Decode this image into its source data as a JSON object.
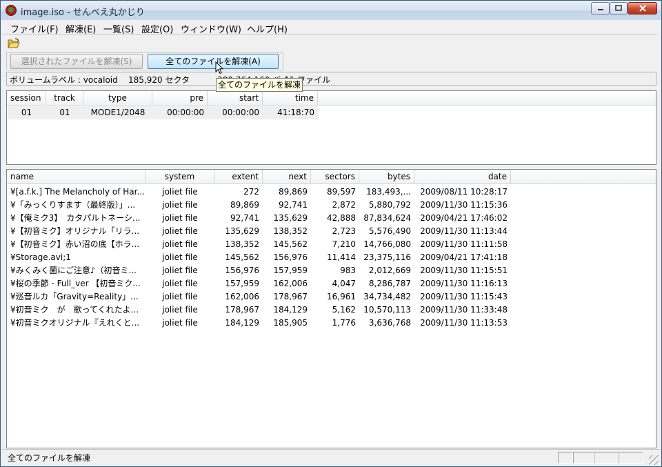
{
  "window": {
    "title": "image.iso - せんべえ丸かじり",
    "min_icon": "minimize-icon",
    "max_icon": "maximize-icon",
    "close_icon": "close-icon"
  },
  "menu": [
    "ファイル(F)",
    "解凍(E)",
    "一覧(S)",
    "設定(O)",
    "ウィンドウ(W)",
    "ヘルプ(H)"
  ],
  "toolbar": {
    "open_icon": "folder-open-icon"
  },
  "buttons": {
    "extract_selected": "選択されたファイルを解凍(S)",
    "extract_all": "全てのファイルを解凍(A)"
  },
  "volume": {
    "label": "ボリュームラベル : vocaloid",
    "sectors": "185,920 セクタ",
    "bytes": "380,764,160 バイト",
    "files": "11 ファイル"
  },
  "tooltip": "全てのファイルを解凍",
  "sessions": {
    "columns": [
      "session",
      "track",
      "type",
      "pre",
      "start",
      "time"
    ],
    "rows": [
      [
        "01",
        "01",
        "MODE1/2048",
        "00:00:00",
        "00:00:00",
        "41:18:70"
      ]
    ]
  },
  "files": {
    "columns": [
      "name",
      "system",
      "extent",
      "next",
      "sectors",
      "bytes",
      "date"
    ],
    "rows": [
      [
        "¥[a.f.k.] The Melancholy of Har...",
        "joliet file",
        "272",
        "89,869",
        "89,597",
        "183,493,...",
        "2009/08/11 10:28:17"
      ],
      [
        "¥「みっくりすます（最終版）」...",
        "joliet file",
        "89,869",
        "92,741",
        "2,872",
        "5,880,792",
        "2009/11/30 11:15:36"
      ],
      [
        "¥【俺ミク3】　カタパルトネーシ...",
        "joliet file",
        "92,741",
        "135,629",
        "42,888",
        "87,834,624",
        "2009/04/21 17:46:02"
      ],
      [
        "¥【初音ミク】オリジナル「リラ...",
        "joliet file",
        "135,629",
        "138,352",
        "2,723",
        "5,576,490",
        "2009/11/30 11:13:44"
      ],
      [
        "¥【初音ミク】赤い沼の底【ホラ...",
        "joliet file",
        "138,352",
        "145,562",
        "7,210",
        "14,766,080",
        "2009/11/30 11:11:58"
      ],
      [
        "¥Storage.avi;1",
        "joliet file",
        "145,562",
        "156,976",
        "11,414",
        "23,375,116",
        "2009/04/21 17:41:18"
      ],
      [
        "¥みくみく菌にご注意♪（初音ミ...",
        "joliet file",
        "156,976",
        "157,959",
        "983",
        "2,012,669",
        "2009/11/30 11:15:51"
      ],
      [
        "¥桜の季節 - Full_ver 【初音ミク...",
        "joliet file",
        "157,959",
        "162,006",
        "4,047",
        "8,286,787",
        "2009/11/30 11:16:13"
      ],
      [
        "¥巡音ルカ「Gravity=Reality」...",
        "joliet file",
        "162,006",
        "178,967",
        "16,961",
        "34,734,482",
        "2009/11/30 11:15:43"
      ],
      [
        "¥初音ミク　が　歌ってくれたよ...",
        "joliet file",
        "178,967",
        "184,129",
        "5,162",
        "10,570,113",
        "2009/11/30 11:33:48"
      ],
      [
        "¥初音ミクオリジナル『えれくと...",
        "joliet file",
        "184,129",
        "185,905",
        "1,776",
        "3,636,768",
        "2009/11/30 11:13:53"
      ]
    ]
  },
  "status": {
    "text": "全てのファイルを解凍"
  }
}
